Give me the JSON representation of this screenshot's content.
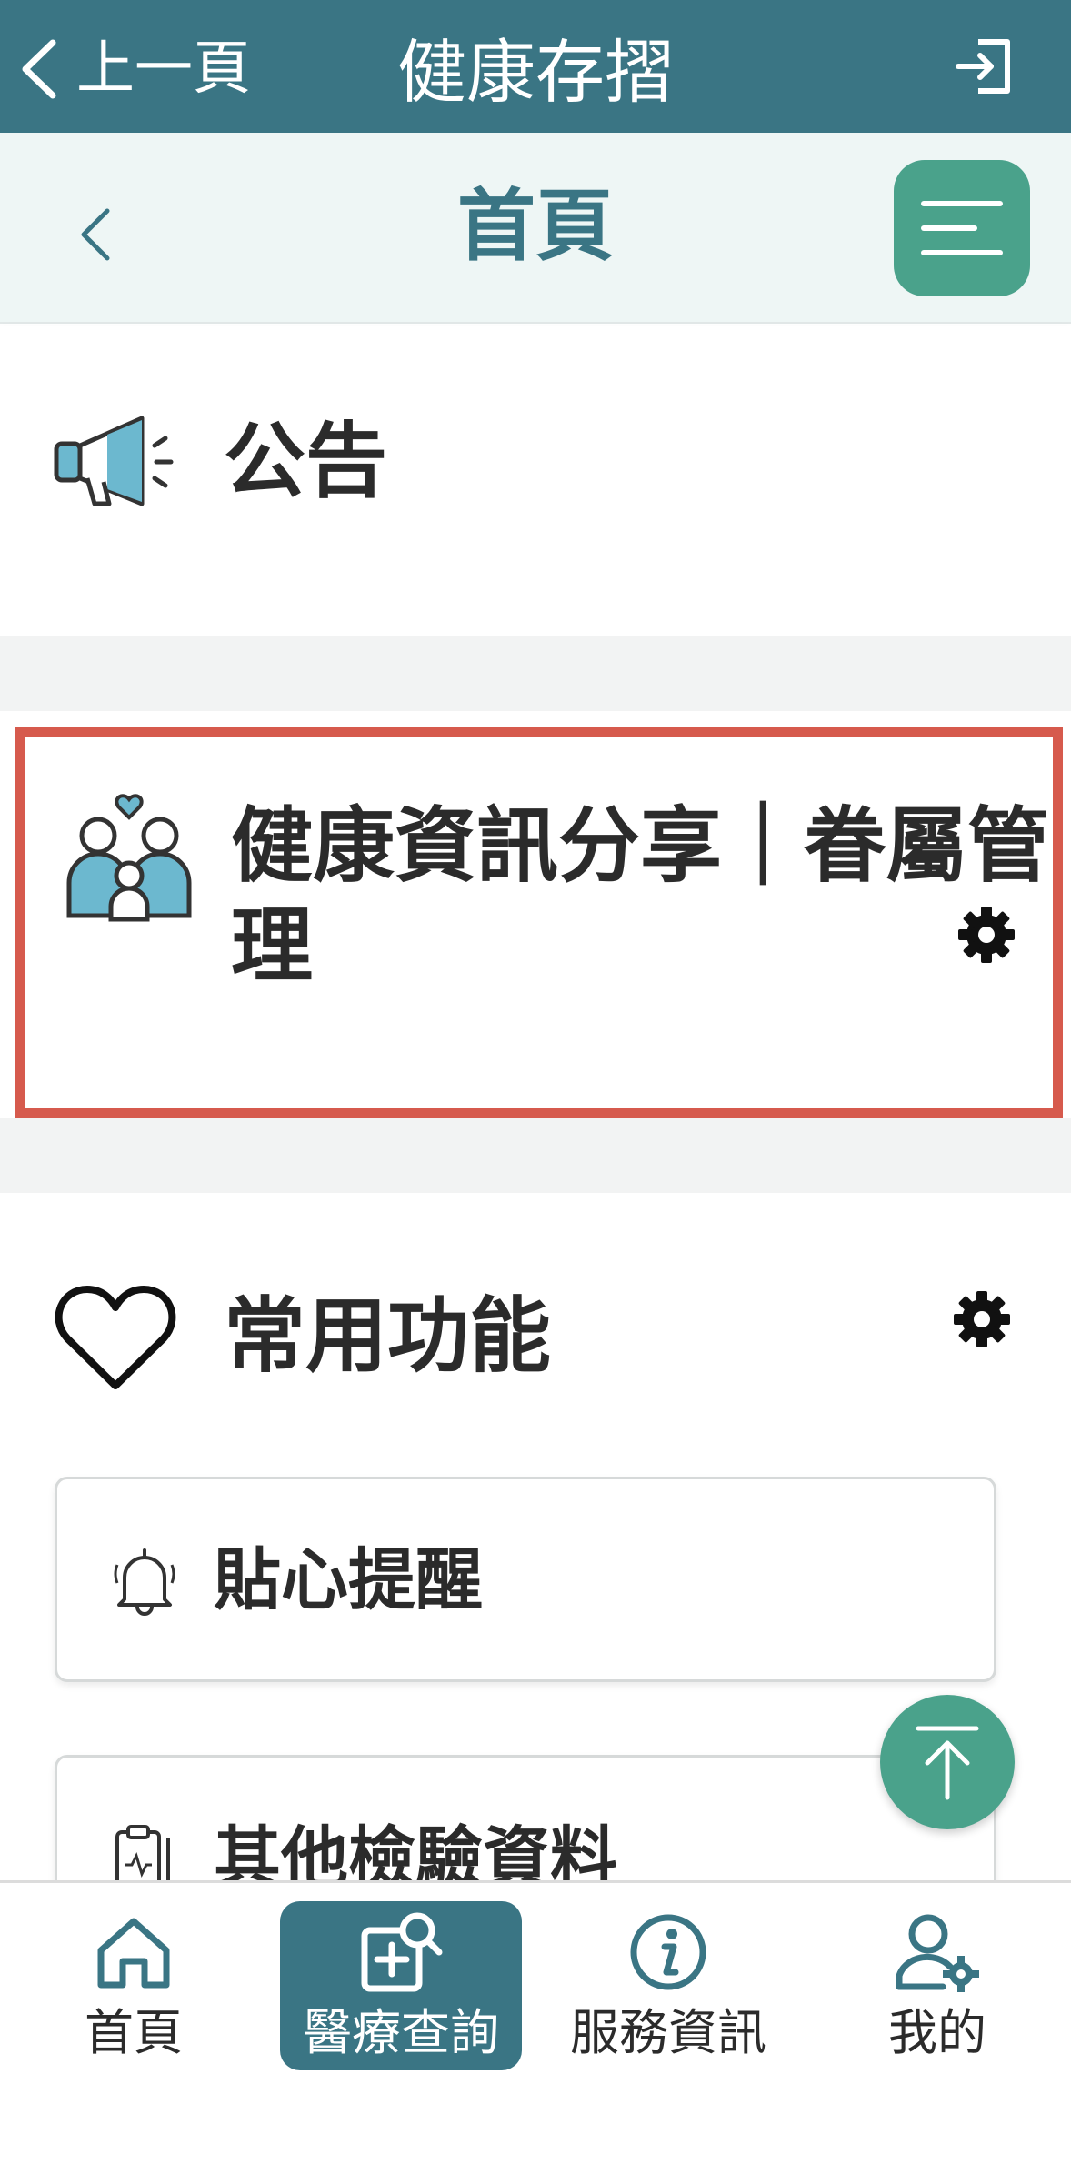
{
  "topbar": {
    "back_label": "上一頁",
    "app_title": "健康存摺"
  },
  "subheader": {
    "title": "首頁"
  },
  "announcement": {
    "title": "公告"
  },
  "health_share": {
    "title_line1": "健康資訊分享｜眷屬管",
    "title_line2": "理"
  },
  "favorites": {
    "title": "常用功能",
    "items": [
      {
        "label": "貼心提醒",
        "icon": "bell-icon"
      },
      {
        "label": "其他檢驗資料",
        "icon": "clipboard-icon"
      }
    ]
  },
  "bottom_nav": [
    {
      "label": "首頁",
      "icon": "home-icon",
      "active": false
    },
    {
      "label": "醫療查詢",
      "icon": "medical-search-icon",
      "active": true
    },
    {
      "label": "服務資訊",
      "icon": "info-icon",
      "active": false
    },
    {
      "label": "我的",
      "icon": "user-settings-icon",
      "active": false
    }
  ],
  "colors": {
    "primary": "#3a7584",
    "accent": "#4aa28b",
    "highlight_border": "#d65a4d"
  }
}
